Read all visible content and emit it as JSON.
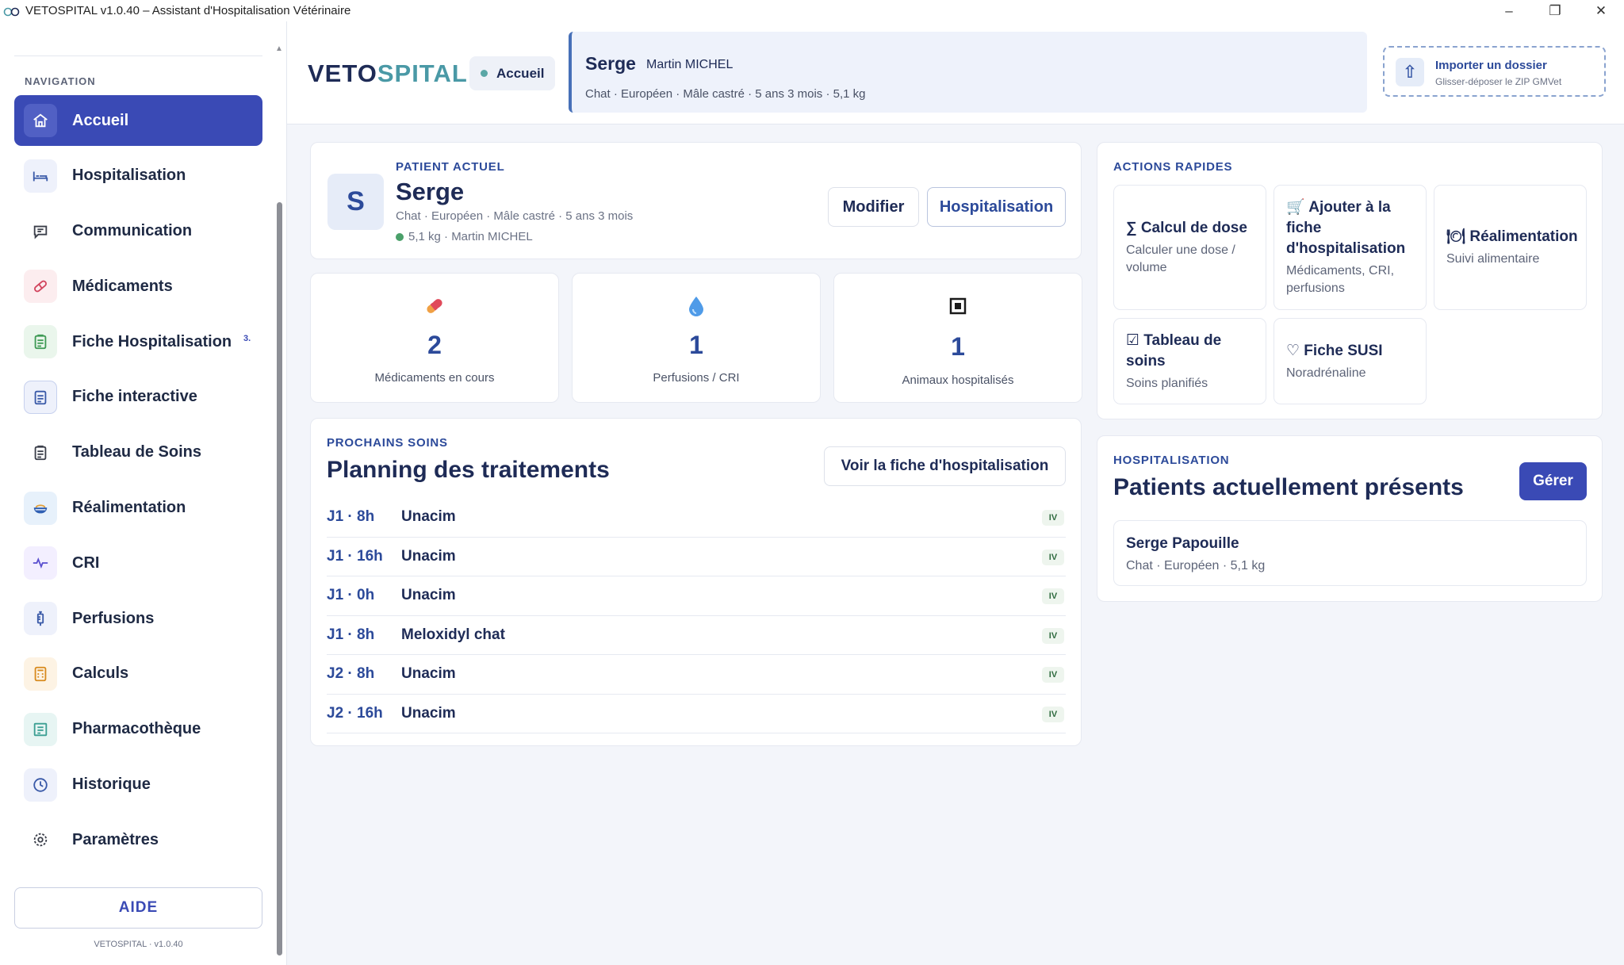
{
  "window": {
    "title": "VETOSPITAL v1.0.40 – Assistant d'Hospitalisation Vétérinaire",
    "minimize": "–",
    "restore": "❐",
    "close": "✕"
  },
  "sidebar": {
    "heading": "NAVIGATION",
    "items": [
      {
        "label": "Accueil",
        "icon": "home-icon",
        "active": true
      },
      {
        "label": "Hospitalisation",
        "icon": "bed-icon"
      },
      {
        "label": "Communication",
        "icon": "chat-icon"
      },
      {
        "label": "Médicaments",
        "icon": "pill-icon"
      },
      {
        "label": "Fiche Hospitalisation",
        "icon": "clipboard-icon",
        "badge": "3."
      },
      {
        "label": "Fiche interactive",
        "icon": "clipboard-icon"
      },
      {
        "label": "Tableau de Soins",
        "icon": "clipboard-icon"
      },
      {
        "label": "Réalimentation",
        "icon": "bowl-icon"
      },
      {
        "label": "CRI",
        "icon": "pulse-icon"
      },
      {
        "label": "Perfusions",
        "icon": "syringe-icon"
      },
      {
        "label": "Calculs",
        "icon": "calculator-icon"
      },
      {
        "label": "Pharmacothèque",
        "icon": "book-icon"
      },
      {
        "label": "Historique",
        "icon": "clock-icon"
      },
      {
        "label": "Paramètres",
        "icon": "gear-icon"
      }
    ],
    "help_label": "AIDE",
    "version": "VETOSPITAL · v1.0.40"
  },
  "header": {
    "logo_part1": "VETO",
    "logo_part2": "SPITAL",
    "breadcrumb": "Accueil",
    "banner": {
      "name": "Serge",
      "owner": "Martin MICHEL",
      "details": "Chat · Européen · Mâle castré · 5 ans 3 mois · 5,1 kg"
    },
    "import": {
      "title": "Importer un dossier",
      "subtitle": "Glisser-déposer le ZIP GMVet"
    }
  },
  "patient": {
    "eyebrow": "PATIENT ACTUEL",
    "initial": "S",
    "name": "Serge",
    "details": "Chat · Européen · Mâle castré · 5 ans 3 mois",
    "weight_owner": "5,1 kg · Martin MICHEL",
    "edit_label": "Modifier",
    "hospit_label": "Hospitalisation"
  },
  "stats": [
    {
      "value": "2",
      "label": "Médicaments en cours",
      "icon": "pill-icon"
    },
    {
      "value": "1",
      "label": "Perfusions / CRI",
      "icon": "droplet-icon"
    },
    {
      "value": "1",
      "label": "Animaux hospitalisés",
      "icon": "square-icon"
    }
  ],
  "planning": {
    "eyebrow": "PROCHAINS SOINS",
    "title": "Planning des traitements",
    "view_label": "Voir la fiche d'hospitalisation",
    "rows": [
      {
        "when": "J1 · 8h",
        "drug": "Unacim",
        "route": "IV"
      },
      {
        "when": "J1 · 16h",
        "drug": "Unacim",
        "route": "IV"
      },
      {
        "when": "J1 · 0h",
        "drug": "Unacim",
        "route": "IV"
      },
      {
        "when": "J1 · 8h",
        "drug": "Meloxidyl chat",
        "route": "IV"
      },
      {
        "when": "J2 · 8h",
        "drug": "Unacim",
        "route": "IV"
      },
      {
        "when": "J2 · 16h",
        "drug": "Unacim",
        "route": "IV"
      }
    ]
  },
  "quick_actions": {
    "eyebrow": "ACTIONS RAPIDES",
    "tiles": [
      {
        "title": "∑ Calcul de dose",
        "subtitle": "Calculer une dose / volume"
      },
      {
        "title": "🛒 Ajouter à la fiche d'hospitalisation",
        "subtitle": "Médicaments, CRI, perfusions"
      },
      {
        "title": "🍽 Réalimentation",
        "subtitle": "Suivi alimentaire"
      },
      {
        "title": "☑ Tableau de soins",
        "subtitle": "Soins planifiés"
      },
      {
        "title": "♡ Fiche SUSI",
        "subtitle": "Noradrénaline"
      }
    ]
  },
  "hospitalisation": {
    "eyebrow": "HOSPITALISATION",
    "title": "Patients actuellement présents",
    "manage_label": "Gérer",
    "patients": [
      {
        "name": "Serge Papouille",
        "details": "Chat · Européen · 5,1 kg"
      }
    ]
  },
  "colors": {
    "accent": "#3a4ab5",
    "brand_dark": "#1e2b56",
    "brand_teal": "#4a99a6"
  }
}
